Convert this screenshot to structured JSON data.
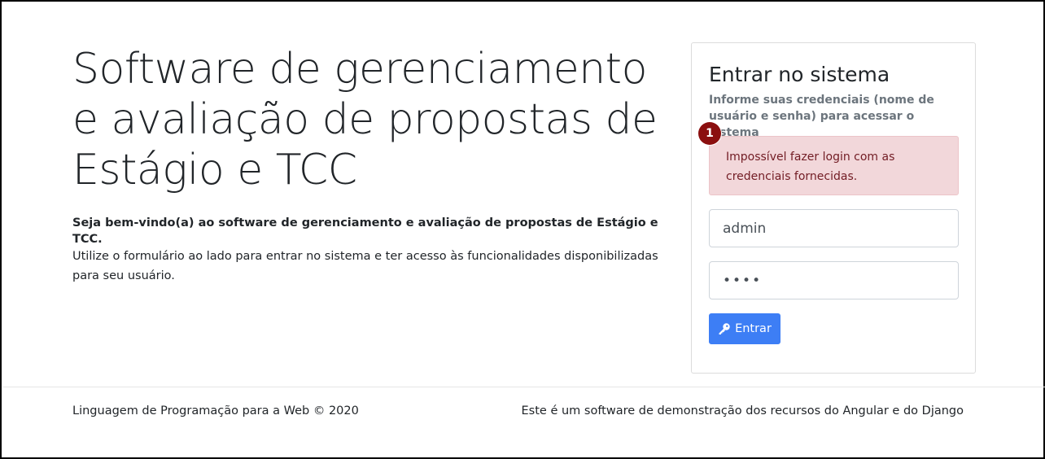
{
  "hero": {
    "title": "Software de gerenciamento e avaliação de propostas de Estágio e TCC",
    "lead": "Seja bem-vindo(a) ao software de gerenciamento e avaliação de propostas de Estágio e TCC.",
    "description": "Utilize o formulário ao lado para entrar no sistema e ter acesso às funcionalidades disponibilizadas para seu usuário."
  },
  "login": {
    "title": "Entrar no sistema",
    "subtitle": "Informe suas credenciais (nome de usuário e senha) para acessar o sistema",
    "error_message": "Impossível fazer login com as credenciais fornecidas.",
    "error_badge": "1",
    "username_value": "admin",
    "password_value": "••••",
    "submit_label": "Entrar",
    "submit_icon": "key-icon",
    "accent_color": "#3d7ef5",
    "error_bg_color": "#f2d7da"
  },
  "footer": {
    "left": "Linguagem de Programação para a Web © 2020",
    "right": "Este é um software de demonstração dos recursos do Angular e do Django"
  }
}
